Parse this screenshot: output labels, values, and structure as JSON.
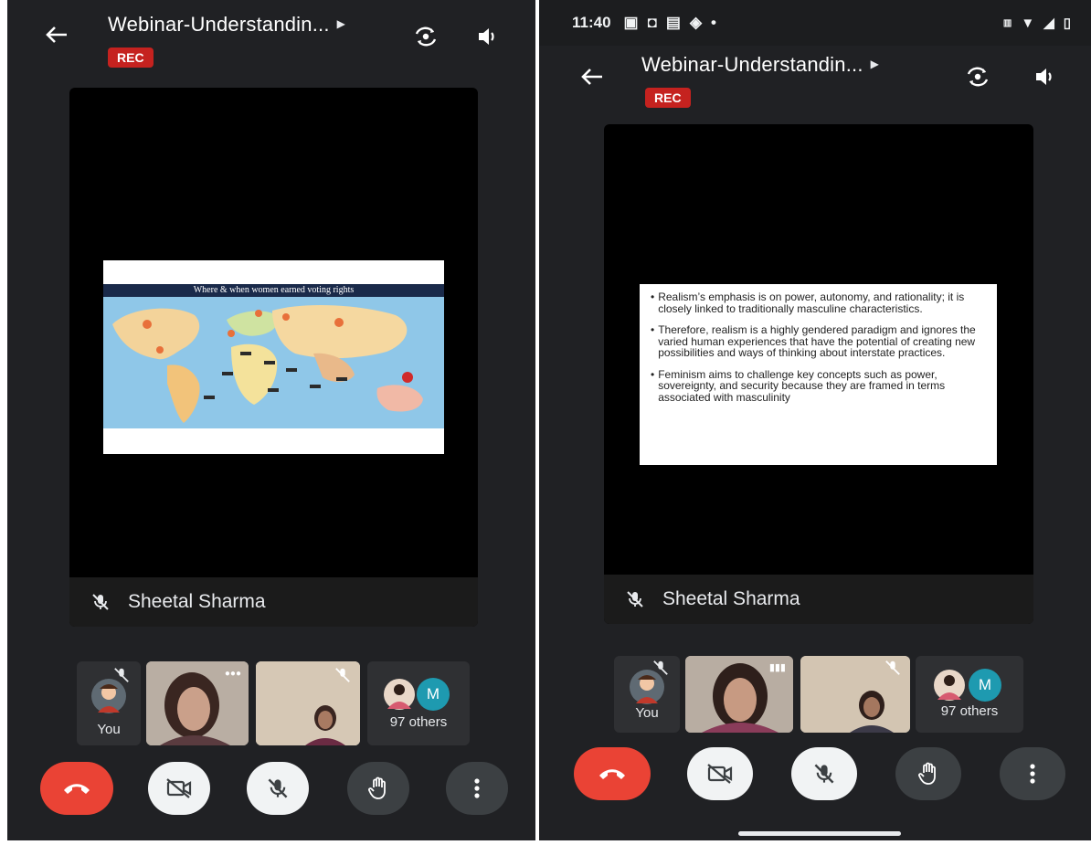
{
  "left": {
    "header": {
      "title": "Webinar-Understandin...",
      "rec_label": "REC"
    },
    "main": {
      "slide_title": "Where & when women earned voting rights",
      "speaker_name": "Sheetal Sharma"
    },
    "participants": {
      "you_label": "You",
      "others_label": "97 others",
      "avatar_letter": "M"
    }
  },
  "right": {
    "status_bar": {
      "time": "11:40"
    },
    "header": {
      "title": "Webinar-Understandin...",
      "rec_label": "REC"
    },
    "main": {
      "bullets": [
        "Realism’s emphasis is on power, autonomy, and rationality; it is closely linked to traditionally masculine characteristics.",
        "Therefore, realism is a highly gendered paradigm and ignores the varied human experiences that have the potential of creating new possibilities and ways of thinking about interstate practices.",
        "Feminism aims to challenge key concepts such as power, sovereignty, and security because they are framed in terms associated with masculinity"
      ],
      "speaker_name": "Sheetal Sharma"
    },
    "participants": {
      "you_label": "You",
      "others_label": "97 others",
      "avatar_letter": "M"
    }
  },
  "colors": {
    "background": "#202124",
    "end_call": "#ea4335",
    "rec": "#c5221f",
    "tile": "#2f3033",
    "avatar": "#1e9ab0"
  },
  "icons": [
    "back-arrow-icon",
    "play-caret-icon",
    "switch-camera-icon",
    "speaker-icon",
    "mic-off-icon",
    "end-call-icon",
    "camera-off-icon",
    "raise-hand-icon",
    "more-vert-icon"
  ]
}
